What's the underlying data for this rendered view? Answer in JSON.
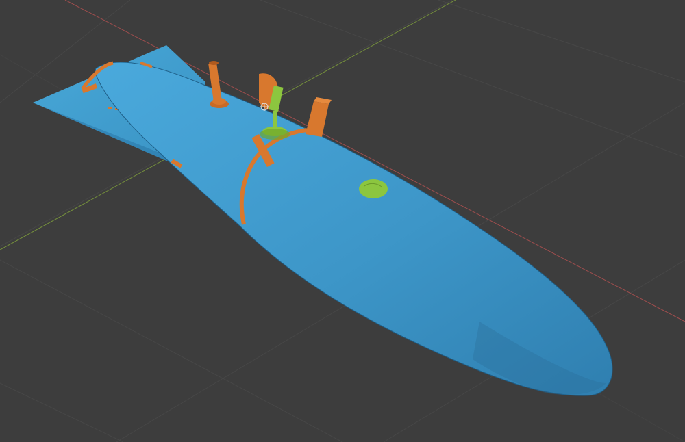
{
  "viewport": {
    "background": "#3d3d3d",
    "grid_color": "#4a4a4a",
    "x_axis_color": "#b85050",
    "y_axis_color": "#7a9a3a"
  },
  "model": {
    "body_color": "#3d96c8",
    "body_shadow": "#2a6e99",
    "detail_color": "#d8782e",
    "selection_color": "#8cc63f"
  },
  "icons": [
    "object-origin-icon"
  ]
}
